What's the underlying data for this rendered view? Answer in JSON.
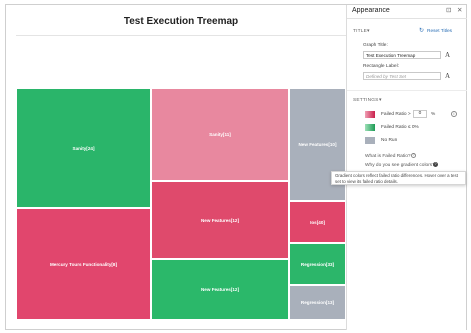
{
  "chart_title": "Test Execution Treemap",
  "colors": {
    "failed_high": "#e0466a",
    "failed_low": "#2db56a",
    "no_run": "#a9b0bb",
    "link": "#2b6fb6"
  },
  "tiles": [
    {
      "label": "Sanity[24]",
      "color": "#2ab56a"
    },
    {
      "label": "Mercury Tours Functionality[8]",
      "color": "#e1466d"
    },
    {
      "label": "Sanity[11]",
      "color": "#e8889f"
    },
    {
      "label": "New Features[12]",
      "color": "#df4a6c"
    },
    {
      "label": "New Features[12]",
      "color": "#2bb86a"
    },
    {
      "label": "New Features[10]",
      "color": "#a9b0bb"
    },
    {
      "label": "Ios[40]",
      "color": "#e0466a"
    },
    {
      "label": "Regression[33]",
      "color": "#2cb66a"
    },
    {
      "label": "Regression[13]",
      "color": "#a9b0bb"
    }
  ],
  "panel": {
    "title": "Appearance",
    "title_section": "TITLE",
    "reset_titles": "Reset Titles",
    "graph_title_label": "Graph Title:",
    "graph_title_value": "Test Execution Treemap",
    "rect_label_label": "Rectangle Label:",
    "rect_label_placeholder": "Defined by Test Set",
    "settings_section": "SETTINGS",
    "failed_ratio_gt_label": "Failed Ratio >",
    "failed_ratio_value": "0",
    "percent_sign": "%",
    "failed_ratio_le_label": "Failed Ratio ≤ 0%",
    "no_run_label": "No Run",
    "what_is_failed_ratio": "What is Failed Ratio?",
    "why_gradient": "Why do you see gradient colors?",
    "tooltip_text": "Gradient colors reflect failed ratio differences. Hover over a test set to view its failed ratio details."
  },
  "icons": {
    "pin": "⊡",
    "close": "✕",
    "reset": "↻",
    "dropdown": "▾",
    "font": "A",
    "info": "i",
    "question": "?"
  }
}
